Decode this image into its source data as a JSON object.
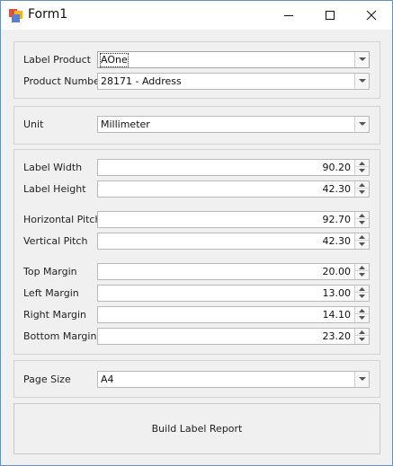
{
  "window": {
    "title": "Form1"
  },
  "product": {
    "label_product_label": "Label Product",
    "label_product_value": "AOne",
    "product_number_label": "Product Number",
    "product_number_value": "28171 - Address"
  },
  "unit": {
    "label": "Unit",
    "value": "Millimeter"
  },
  "dimensions": [
    {
      "label": "Label Width",
      "value": "90.20"
    },
    {
      "label": "Label Height",
      "value": "42.30"
    },
    {
      "label": "Horizontal Pitch",
      "value": "92.70"
    },
    {
      "label": "Vertical Pitch",
      "value": "42.30"
    },
    {
      "label": "Top Margin",
      "value": "20.00"
    },
    {
      "label": "Left Margin",
      "value": "13.00"
    },
    {
      "label": "Right Margin",
      "value": "14.10"
    },
    {
      "label": "Bottom Margin",
      "value": "23.20"
    }
  ],
  "page_size": {
    "label": "Page Size",
    "value": "A4"
  },
  "build_button": {
    "label": "Build Label Report"
  },
  "icons": [
    "app-icon",
    "minimize-icon",
    "maximize-icon",
    "close-icon",
    "chevron-down-icon",
    "spin-up-icon",
    "spin-down-icon"
  ]
}
